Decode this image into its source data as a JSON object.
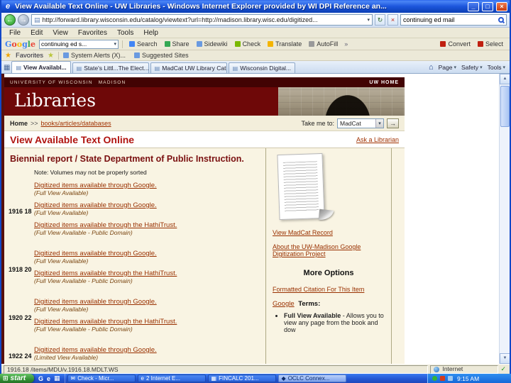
{
  "icons": {
    "ie-logo": "e",
    "minimize": "_",
    "maximize": "□",
    "close": "×",
    "back": "←",
    "forward": "→",
    "refresh": "↻",
    "stop": "×",
    "dropdown": "▾",
    "page": "▤",
    "star": "★",
    "star-plus": "★",
    "home": "⌂",
    "chevron": "»",
    "quicktabs": "▦",
    "scroll-up": "▲",
    "scroll-down": "▼",
    "check": "✓",
    "win-flag": "⊞",
    "go": "→"
  },
  "titlebar": {
    "title": "View Available Text Online - UW Libraries - Windows Internet Explorer provided by WI DPI Reference an..."
  },
  "navbar": {
    "address": "http://forward.library.wisconsin.edu/catalog/viewtext?url=http://madison.library.wisc.edu/digitized...",
    "search_value": "continuing ed mail"
  },
  "menubar": {
    "items": [
      "File",
      "Edit",
      "View",
      "Favorites",
      "Tools",
      "Help"
    ]
  },
  "google_toolbar": {
    "logo_letters": [
      "G",
      "o",
      "o",
      "g",
      "l",
      "e"
    ],
    "search_value": "continuing ed s...",
    "buttons": [
      {
        "label": "Search"
      },
      {
        "label": "Share"
      },
      {
        "label": "Sidewiki"
      },
      {
        "label": "Check"
      },
      {
        "label": "Translate"
      },
      {
        "label": "AutoFill"
      }
    ],
    "right_buttons": [
      {
        "label": "Convert"
      },
      {
        "label": "Select"
      }
    ]
  },
  "favorites_bar": {
    "favorites_label": "Favorites",
    "items": [
      {
        "label": "System Alerts (X)..."
      },
      {
        "label": "Suggested Sites"
      }
    ]
  },
  "tab_bar": {
    "tabs": [
      {
        "label": "View Availabl..."
      },
      {
        "label": "State's Littl...The Elect..."
      },
      {
        "label": "MadCat UW Library Cat..."
      },
      {
        "label": "Wisconsin Digital..."
      }
    ],
    "commands": [
      "Page",
      "Safety",
      "Tools"
    ]
  },
  "site": {
    "university": "UNIVERSITY OF WISCONSIN",
    "campus": "MADISON",
    "uw_home": "UW HOME",
    "libraries": "Libraries",
    "breadcrumb_home": "Home",
    "breadcrumb_sep": ">>",
    "breadcrumb_path": "books/articles/databases",
    "take_me_to": "Take me to:",
    "take_me_to_value": "MadCat",
    "page_title": "View Available Text Online",
    "ask_librarian": "Ask a Librarian"
  },
  "content": {
    "heading": "Biennial report / State Department of Public Instruction.",
    "note": "Note: Volumes may not be properly sorted",
    "volumes": [
      {
        "year": "1916 18",
        "entries": [
          {
            "link": "Digitized items available through Google.",
            "note": "(Full View Available)"
          },
          {
            "link": "Digitized items available through Google.",
            "note": "(Full View Available)"
          },
          {
            "link": "Digitized items available through the HathiTrust.",
            "note": "(Full View Available - Public Domain)"
          }
        ]
      },
      {
        "year": "1918 20",
        "entries": [
          {
            "link": "Digitized items available through Google.",
            "note": "(Full View Available)"
          },
          {
            "link": "Digitized items available through the HathiTrust.",
            "note": "(Full View Available - Public Domain)"
          }
        ]
      },
      {
        "year": "1920 22",
        "entries": [
          {
            "link": "Digitized items available through Google.",
            "note": "(Full View Available)"
          },
          {
            "link": "Digitized items available through the HathiTrust.",
            "note": "(Full View Available - Public Domain)"
          }
        ]
      },
      {
        "year": "1922 24",
        "entries": [
          {
            "link": "Digitized items available through Google.",
            "note": "(Limited View Available)"
          }
        ]
      }
    ]
  },
  "sidebar": {
    "view_record": "View MadCat Record",
    "about_link": "About the UW-Madison Google Digitization Project",
    "more_options": "More Options",
    "citation_link": "Formatted Citation For This Item",
    "google_label": "Google",
    "terms_label": "Terms:",
    "terms": [
      {
        "term": "Full View Available",
        "desc": "- Allows you to view any page from the book and dow"
      }
    ]
  },
  "statusbar": {
    "left": "1916.18 /items/MDU/v.1916.18.MDLT.WS",
    "zone": "Internet"
  },
  "taskbar": {
    "start_label": "start",
    "quick_launch": [
      "G",
      "e",
      "▦"
    ],
    "buttons": [
      {
        "glyph": "✉",
        "label": "Check - Micr..."
      },
      {
        "glyph": "e",
        "label": "2 Internet E..."
      },
      {
        "glyph": "▦",
        "label": "FINCALC 201..."
      },
      {
        "glyph": "◆",
        "label": "OCLC Connex..."
      }
    ],
    "clock": "9:15 AM"
  }
}
